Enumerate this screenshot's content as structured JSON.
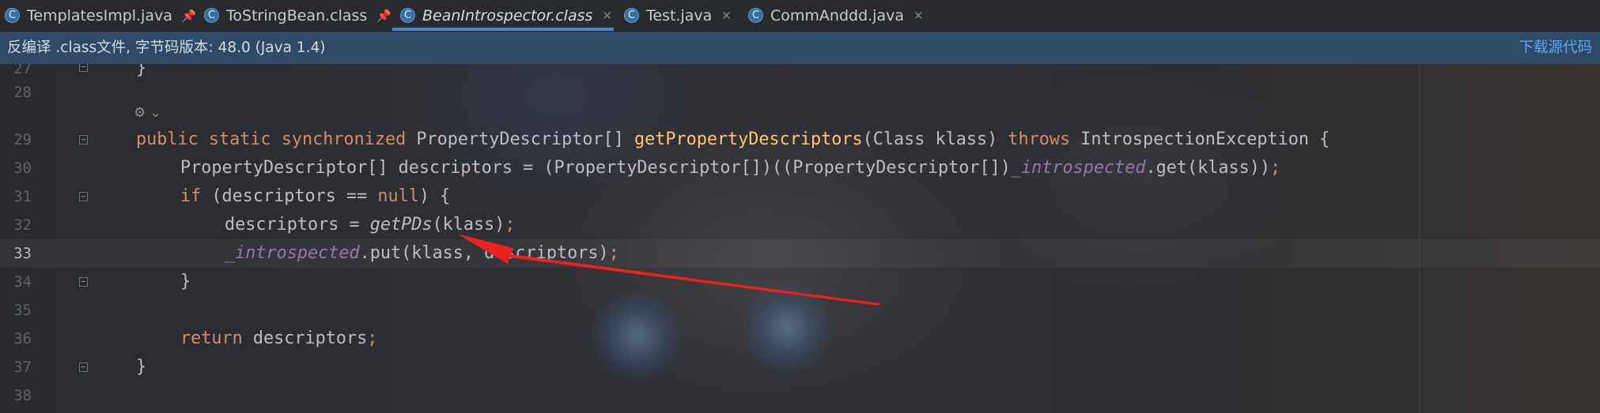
{
  "tabs": [
    {
      "label": "TemplatesImpl.java",
      "icon": "class-icon",
      "action": "pin-icon",
      "active": false
    },
    {
      "label": "ToStringBean.class",
      "icon": "class-icon",
      "action": "pin-icon",
      "active": false
    },
    {
      "label": "BeanIntrospector.class",
      "icon": "class-icon",
      "action": "close-icon",
      "active": true
    },
    {
      "label": "Test.java",
      "icon": "class-icon",
      "action": "close-icon",
      "active": false
    },
    {
      "label": "CommAnddd.java",
      "icon": "class-icon",
      "action": "close-icon",
      "active": false
    }
  ],
  "banner": {
    "text": "反编译 .class文件, 字节码版本: 48.0 (Java 1.4)",
    "link": "下载源代码"
  },
  "editor": {
    "current_line": "33",
    "lines": [
      {
        "num": "27",
        "code": "}"
      },
      {
        "num": "28",
        "code": ""
      },
      {
        "num": "29",
        "code": "public static synchronized PropertyDescriptor[] getPropertyDescriptors(Class klass) throws IntrospectionException {"
      },
      {
        "num": "30",
        "code": "PropertyDescriptor[] descriptors = (PropertyDescriptor[])((PropertyDescriptor[])_introspected.get(klass));"
      },
      {
        "num": "31",
        "code": "if (descriptors == null) {"
      },
      {
        "num": "32",
        "code": "descriptors = getPDs(klass);"
      },
      {
        "num": "33",
        "code": "_introspected.put(klass, descriptors);"
      },
      {
        "num": "34",
        "code": "}"
      },
      {
        "num": "35",
        "code": ""
      },
      {
        "num": "36",
        "code": "return descriptors;"
      },
      {
        "num": "37",
        "code": "}"
      },
      {
        "num": "38",
        "code": ""
      }
    ]
  },
  "colors": {
    "keyword": "#cf8e6d",
    "method": "#ffc66d",
    "field": "#9876aa",
    "text": "#bcbec4",
    "banner_bg": "#2e4a68",
    "link": "#5fa8f0",
    "arrow": "#e8231f"
  }
}
